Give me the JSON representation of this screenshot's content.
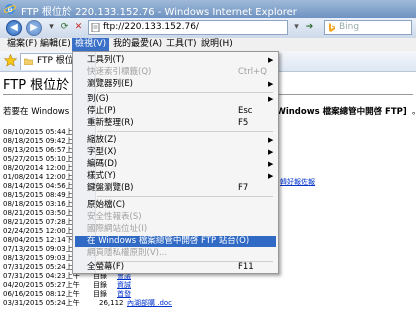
{
  "window": {
    "title": "FTP 根位於 220.133.152.76 - Windows Internet Explorer"
  },
  "address": {
    "url": "ftp://220.133.152.76/",
    "search_placeholder": "Bing"
  },
  "menubar": {
    "items": [
      "檔案(F)",
      "編輯(E)",
      "檢視(V)",
      "我的最愛(A)",
      "工具(T)",
      "說明(H)"
    ]
  },
  "tab": {
    "label": "FTP 根位於"
  },
  "page": {
    "heading": "FTP 根位於",
    "intro_left": "若要在 Windows 檔",
    "intro_right": "在 Windows 檔案總管中開啓 FTP]",
    "intro_tail": "。",
    "stray_link": "韓好報佐報"
  },
  "view_menu": [
    {
      "label": "工具列(T)",
      "shortcut": "",
      "arrow": true,
      "disabled": false
    },
    {
      "label": "快速索引標籤(Q)",
      "shortcut": "Ctrl+Q",
      "arrow": false,
      "disabled": true
    },
    {
      "label": "瀏覽器列(E)",
      "shortcut": "",
      "arrow": true,
      "disabled": false
    },
    {
      "label": "到(G)",
      "shortcut": "",
      "arrow": true,
      "disabled": false
    },
    {
      "label": "停止(P)",
      "shortcut": "Esc",
      "arrow": false,
      "disabled": false
    },
    {
      "label": "重新整理(R)",
      "shortcut": "F5",
      "arrow": false,
      "disabled": false
    },
    {
      "label": "縮放(Z)",
      "shortcut": "",
      "arrow": true,
      "disabled": false
    },
    {
      "label": "字型(X)",
      "shortcut": "",
      "arrow": true,
      "disabled": false
    },
    {
      "label": "編碼(D)",
      "shortcut": "",
      "arrow": true,
      "disabled": false
    },
    {
      "label": "樣式(Y)",
      "shortcut": "",
      "arrow": true,
      "disabled": false
    },
    {
      "label": "鍵盤瀏覽(B)",
      "shortcut": "F7",
      "arrow": false,
      "disabled": false
    },
    {
      "label": "原始檔(C)",
      "shortcut": "",
      "arrow": false,
      "disabled": false
    },
    {
      "label": "安全性報表(S)",
      "shortcut": "",
      "arrow": false,
      "disabled": true
    },
    {
      "label": "國際網站位址(I)",
      "shortcut": "",
      "arrow": false,
      "disabled": true
    },
    {
      "label": "在 Windows 檔案總管中開啓 FTP 站台(O)",
      "shortcut": "",
      "arrow": false,
      "disabled": false,
      "highlighted": true
    },
    {
      "label": "網頁隱私權原則(V)...",
      "shortcut": "",
      "arrow": false,
      "disabled": true
    },
    {
      "label": "全螢幕(F)",
      "shortcut": "F11",
      "arrow": false,
      "disabled": false
    }
  ],
  "listing": [
    {
      "date": "08/10/2015 05:44上午",
      "type": "",
      "size": "",
      "name": ""
    },
    {
      "date": "08/18/2015 09:42上午",
      "type": "",
      "size": "",
      "name": ""
    },
    {
      "date": "08/13/2015 06:57上午",
      "type": "",
      "size": "",
      "name": ""
    },
    {
      "date": "05/27/2015 05:10上午",
      "type": "",
      "size": "",
      "name": ""
    },
    {
      "date": "08/20/2014 12:00上午",
      "type": "",
      "size": "",
      "name": ""
    },
    {
      "date": "01/08/2014 12:00上午",
      "type": "",
      "size": "",
      "name": ""
    },
    {
      "date": "08/14/2015 04:56上午",
      "type": "",
      "size": "",
      "name": ""
    },
    {
      "date": "08/15/2015 08:49上午",
      "type": "",
      "size": "",
      "name": ""
    },
    {
      "date": "08/18/2015 03:16上午",
      "type": "",
      "size": "",
      "name": ""
    },
    {
      "date": "08/21/2015 03:50上午",
      "type": "",
      "size": "",
      "name": ""
    },
    {
      "date": "08/21/2015 07:28上午",
      "type": "",
      "size": "",
      "name": ""
    },
    {
      "date": "02/24/2015 12:00上午",
      "type": "",
      "size": "",
      "name": ""
    },
    {
      "date": "08/04/2015 12:14下午",
      "type": "",
      "size": "",
      "name": ""
    },
    {
      "date": "07/13/2015 09:03上午",
      "type": "",
      "size": "",
      "name": ""
    },
    {
      "date": "08/13/2015 09:03上午",
      "type": "",
      "size": "",
      "name": ""
    },
    {
      "date": "07/31/2015 05:24上午",
      "type": "目錄",
      "size": "",
      "name": "財務"
    },
    {
      "date": "07/31/2015 04:23上午",
      "type": "目錄",
      "size": "",
      "name": "會議"
    },
    {
      "date": "04/20/2015 05:27上午",
      "type": "目錄",
      "size": "",
      "name": "資誠"
    },
    {
      "date": "06/16/2015 08:12上午",
      "type": "目錄",
      "size": "",
      "name": "首發"
    },
    {
      "date": "03/31/2015 05:24上午",
      "type": "",
      "size": "26,112",
      "name": "內湖部購 .doc"
    }
  ]
}
